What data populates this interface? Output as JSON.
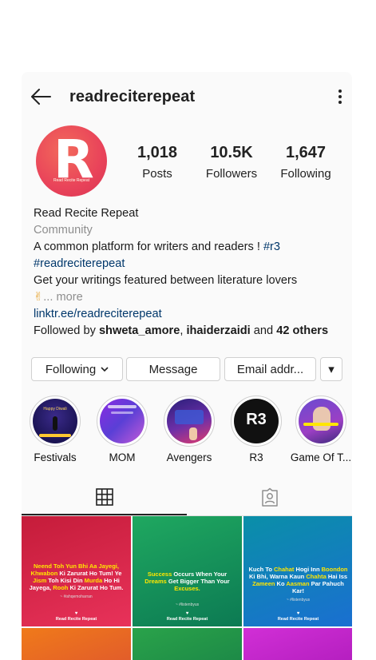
{
  "header": {
    "username": "readreciterepeat"
  },
  "profile": {
    "avatar_letter": "R",
    "avatar_caption": "Read Recite Repeat",
    "stats": [
      {
        "value": "1,018",
        "label": "Posts"
      },
      {
        "value": "10.5K",
        "label": "Followers"
      },
      {
        "value": "1,647",
        "label": "Following"
      }
    ]
  },
  "bio": {
    "name": "Read Recite Repeat",
    "category": "Community",
    "line1": "A common platform for writers and readers ! ",
    "hashtag1": "#r3",
    "hashtag2": "#readreciterepeat",
    "line3": "Get your writings featured between literature lovers",
    "emoji": "✌",
    "more": "... more",
    "link": "linktr.ee/readreciterepeat",
    "followed_prefix": "Followed by ",
    "follower1": "shweta_amore",
    "separator": ", ",
    "follower2": "ihaiderzaidi",
    "and_text": " and ",
    "others": "42 others"
  },
  "actions": {
    "following": "Following",
    "message": "Message",
    "email": "Email addr...",
    "dropdown": "▾"
  },
  "highlights": [
    {
      "label": "Festivals",
      "inner_text": "Happy Diwali"
    },
    {
      "label": "MOM",
      "inner_text": ""
    },
    {
      "label": "Avengers",
      "inner_text": ""
    },
    {
      "label": "R3",
      "inner_text": "R3"
    },
    {
      "label": "Game Of T...",
      "inner_text": ""
    }
  ],
  "posts": [
    {
      "quote_parts": [
        {
          "t": "Neend ",
          "y": true
        },
        {
          "t": "Toh Yun Bhi Aa Jayegi, ",
          "y": true
        },
        {
          "t": "Khwabon ",
          "y": true
        },
        {
          "t": "Ki Zarurat Ho Tum!",
          "y": false
        },
        {
          "t": " Ye ",
          "y": false
        },
        {
          "t": "Jism ",
          "y": true
        },
        {
          "t": "Toh Kisi Din ",
          "y": false
        },
        {
          "t": "Murda ",
          "y": true
        },
        {
          "t": "Ho Hi Jayega, ",
          "y": false
        },
        {
          "t": "Rooh ",
          "y": true
        },
        {
          "t": "Ki Zarurat Ho Tum.",
          "y": false
        }
      ],
      "tag": "~ #ishqemoharran",
      "brand": "Read Recite Repeat",
      "colors": [
        "#c51c3a",
        "#e8325a"
      ]
    },
    {
      "quote_parts": [
        {
          "t": "Success ",
          "y": true
        },
        {
          "t": "Occurs When Your ",
          "y": false
        },
        {
          "t": "Dreams ",
          "y": true
        },
        {
          "t": "Get Bigger Than Your ",
          "y": false
        },
        {
          "t": "Excuses.",
          "y": true
        }
      ],
      "tag": "~ #listenbyus",
      "brand": "Read Recite Repeat",
      "colors": [
        "#1fa860",
        "#0c7a53"
      ]
    },
    {
      "quote_parts": [
        {
          "t": "Kuch To ",
          "y": false
        },
        {
          "t": "Chahat ",
          "y": true
        },
        {
          "t": "Hogi Inn ",
          "y": false
        },
        {
          "t": "Boondon ",
          "y": true
        },
        {
          "t": "Ki Bhi, Warna Kaun ",
          "y": false
        },
        {
          "t": "Chahta ",
          "y": true
        },
        {
          "t": "Hai Iss ",
          "y": false
        },
        {
          "t": "Zameen ",
          "y": true
        },
        {
          "t": "Ko ",
          "y": false
        },
        {
          "t": "Aasman ",
          "y": true
        },
        {
          "t": "Par Pahuch Kar!",
          "y": false
        }
      ],
      "tag": "~ #listenbyus",
      "brand": "Read Recite Repeat",
      "colors": [
        "#0a8fa8",
        "#1a6fd1"
      ]
    },
    {
      "quote_parts": [],
      "tag": "",
      "brand": "",
      "colors": [
        "#f07a1a",
        "#e25d2a"
      ]
    },
    {
      "quote_parts": [],
      "tag": "",
      "brand": "",
      "colors": [
        "#2aa34a",
        "#1d8a47"
      ]
    },
    {
      "quote_parts": [],
      "tag": "",
      "brand": "",
      "colors": [
        "#d12fd6",
        "#b51fc0"
      ]
    }
  ],
  "colors": {
    "accent_link": "#00376b",
    "muted": "#8e8e8e",
    "avatar": "#e9435a"
  }
}
